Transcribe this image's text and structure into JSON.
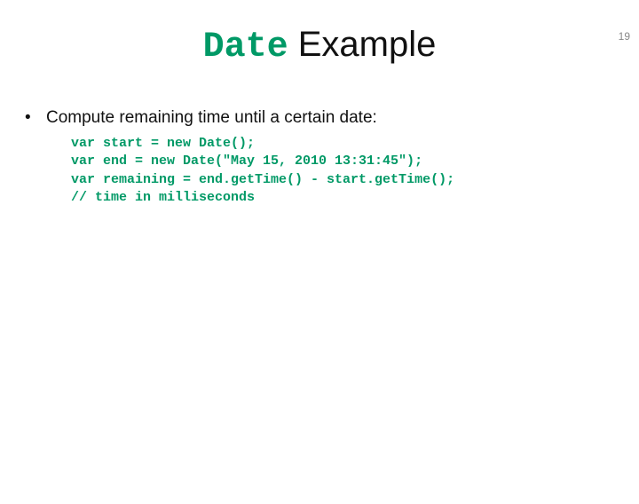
{
  "page_number": "19",
  "title": {
    "code_part": "Date",
    "rest": " Example"
  },
  "bullet": {
    "marker": "•",
    "text": "Compute remaining time until a certain date:"
  },
  "code": {
    "line1": "var start = new Date();",
    "line2": "var end = new Date(\"May 15, 2010 13:31:45\");",
    "line3": "var remaining = end.getTime() - start.getTime();",
    "line4": "// time in milliseconds"
  }
}
